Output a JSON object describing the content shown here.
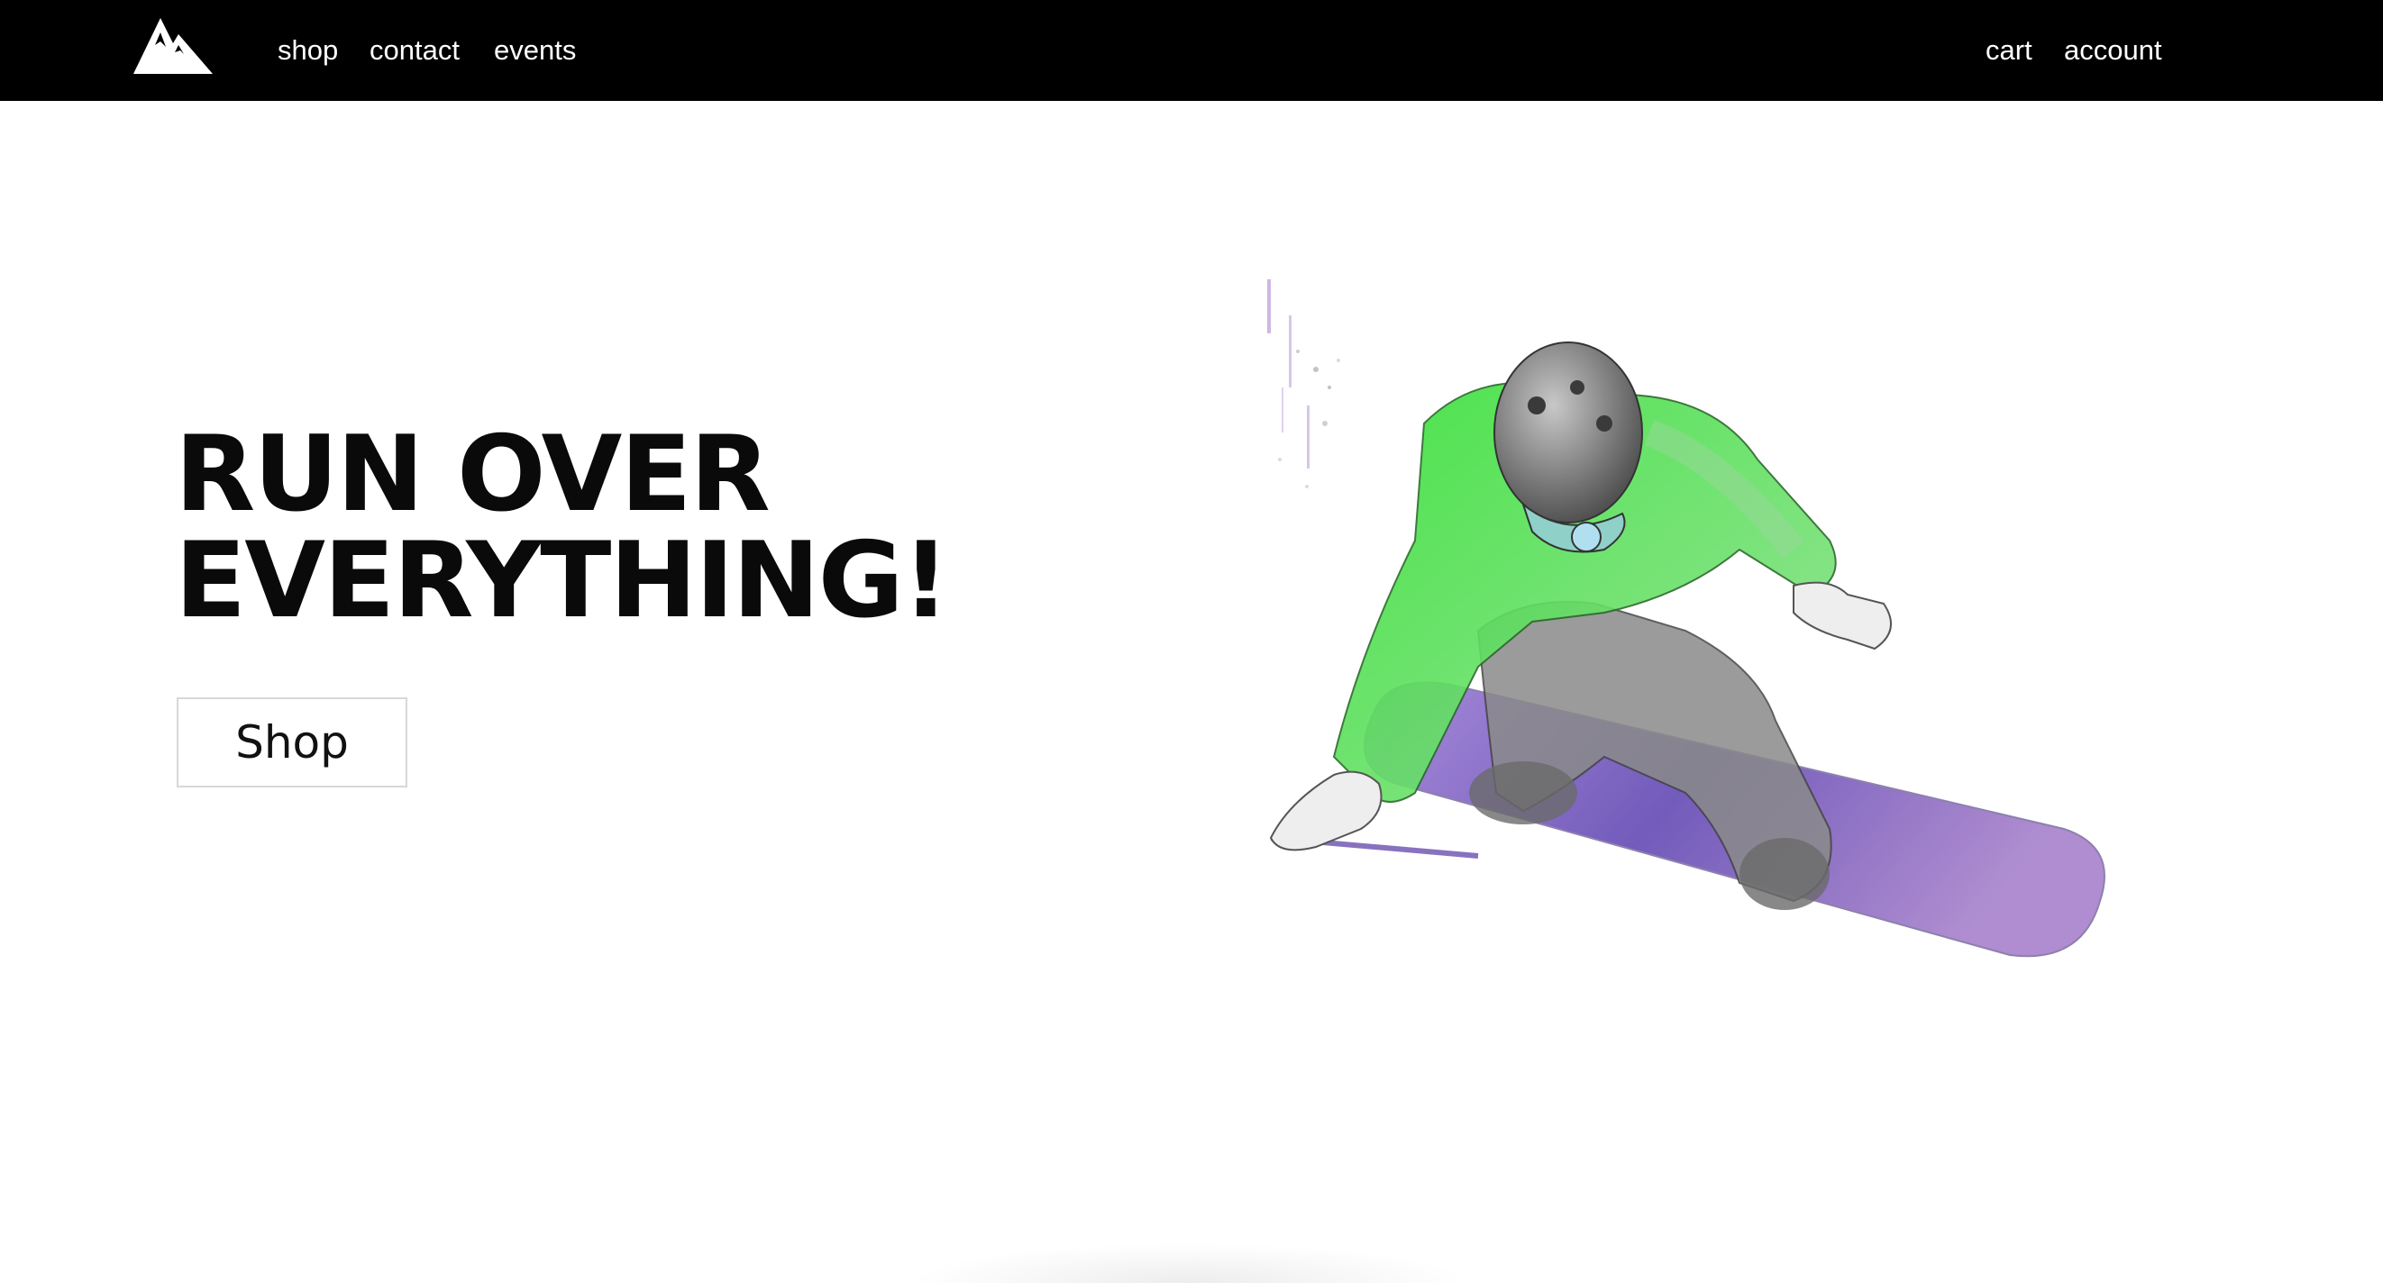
{
  "brand": {
    "logo_icon": "mountain-logo-icon"
  },
  "nav": {
    "left": [
      {
        "label": "shop"
      },
      {
        "label": "contact"
      },
      {
        "label": "events"
      }
    ],
    "right": [
      {
        "label": "cart"
      },
      {
        "label": "account"
      }
    ]
  },
  "hero": {
    "title_line1": "RUN OVER",
    "title_line2": "EVERYTHING!",
    "button_label": "Shop",
    "illustration_icon": "snowboarder-illustration"
  },
  "colors": {
    "header_bg": "#000000",
    "header_text": "#ffffff",
    "page_bg": "#ffffff",
    "jacket_green": "#2fe02f",
    "board_purple": "#7b4fc0",
    "helmet_gray": "#6e6e6e"
  }
}
